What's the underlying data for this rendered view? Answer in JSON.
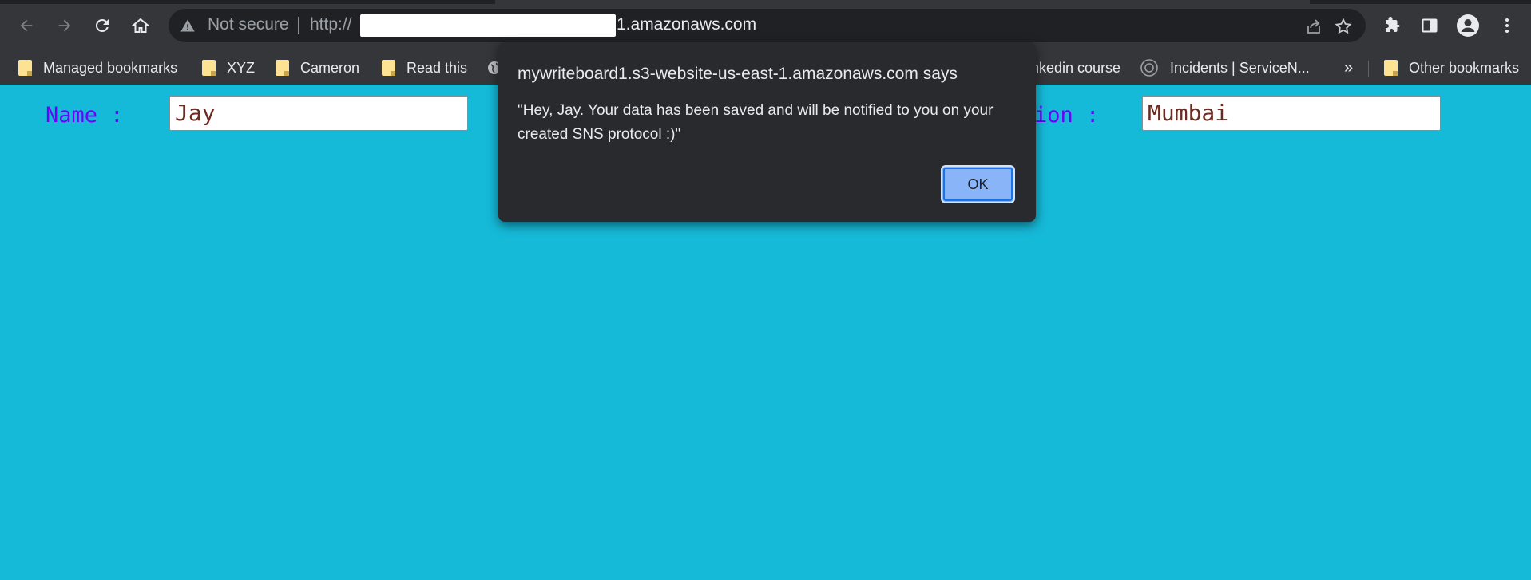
{
  "browser": {
    "omnibox": {
      "security_text": "Not secure",
      "url_prefix": "http://",
      "url_suffix": "1.amazonaws.com"
    },
    "bookmarks": [
      {
        "label": "Managed bookmarks",
        "icon": "folder-icon"
      },
      {
        "label": "XYZ",
        "icon": "folder-icon"
      },
      {
        "label": "Cameron",
        "icon": "folder-icon"
      },
      {
        "label": "Read this",
        "icon": "folder-icon"
      },
      {
        "label": "nkedin course",
        "icon": "none"
      },
      {
        "label": "Incidents | ServiceN...",
        "icon": "servicenow-icon"
      },
      {
        "label": "Other bookmarks",
        "icon": "folder-icon"
      }
    ],
    "overflow_label": "»",
    "colors": {
      "toolbar": "#35363a",
      "omnibox": "#202124",
      "folder": "#fde293"
    }
  },
  "form": {
    "name_label": "Name :",
    "name_value": "Jay",
    "location_label_partial": "ion :",
    "location_value": "Mumbai",
    "colors": {
      "background": "#15bad8",
      "label": "#6b00ff",
      "value": "#6b2b22"
    }
  },
  "dialog": {
    "title": "mywriteboard1.s3-website-us-east-1.amazonaws.com says",
    "message": "\"Hey, Jay. Your data has been saved and will be notified to you on your created SNS protocol :)\"",
    "ok_label": "OK",
    "colors": {
      "background": "#292a2d",
      "button": "#8ab4f8"
    }
  }
}
